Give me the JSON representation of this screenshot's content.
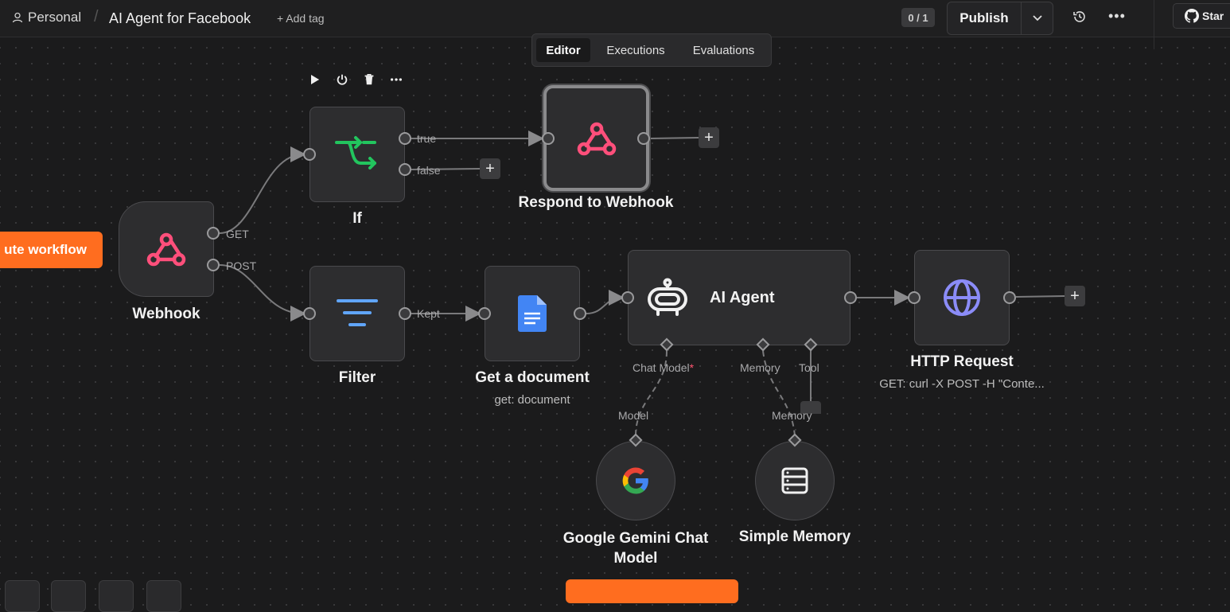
{
  "header": {
    "breadcrumb_project": "Personal",
    "workflow_title": "AI Agent for Facebook",
    "add_tag_label": "+ Add tag",
    "counter": "0 / 1",
    "publish_label": "Publish",
    "star_label": "Star"
  },
  "tabs": [
    {
      "label": "Editor",
      "active": true
    },
    {
      "label": "Executions",
      "active": false
    },
    {
      "label": "Evaluations",
      "active": false
    }
  ],
  "nodes": {
    "webhook": {
      "label": "Webhook",
      "outputs": [
        "GET",
        "POST"
      ],
      "icon": "webhook-icon"
    },
    "if": {
      "label": "If",
      "outputs": [
        "true",
        "false"
      ],
      "icon": "branch-icon"
    },
    "respond": {
      "label": "Respond to Webhook",
      "icon": "webhook-icon"
    },
    "filter": {
      "label": "Filter",
      "outputs": [
        "Kept"
      ],
      "icon": "filter-icon"
    },
    "get_document": {
      "label": "Get a document",
      "subtitle": "get: document",
      "icon": "google-docs-icon"
    },
    "ai_agent": {
      "label": "AI Agent",
      "inputs": [
        "Chat Model",
        "Memory",
        "Tool"
      ],
      "required_marker": "*",
      "icon": "robot-icon"
    },
    "http_request": {
      "label": "HTTP Request",
      "subtitle": "GET: curl -X POST -H \"Conte...",
      "icon": "globe-icon"
    },
    "gemini": {
      "label_line1": "Google Gemini Chat",
      "label_line2": "Model",
      "handle_label": "Model",
      "icon": "google-icon"
    },
    "memory": {
      "label": "Simple Memory",
      "handle_label": "Memory",
      "icon": "database-icon"
    }
  },
  "canvas": {
    "execute_button_label": "ute workflow"
  },
  "colors": {
    "accent_orange": "#ff6d1f",
    "webhook_pink": "#ff4f7b",
    "if_green": "#22c55e",
    "filter_blue": "#60a5fa",
    "http_purple": "#8b8cf8"
  }
}
